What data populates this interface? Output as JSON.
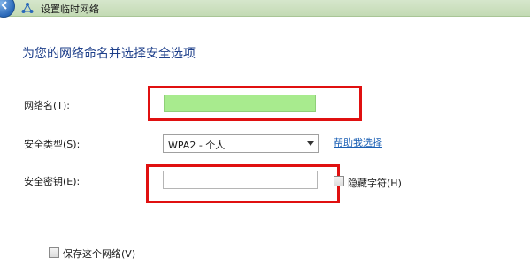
{
  "window": {
    "title": "设置临时网络",
    "back_icon": "back-arrow-icon",
    "title_icon": "network-icon"
  },
  "heading": "为您的网络命名并选择安全选项",
  "form": {
    "network_name_label": "网络名(T):",
    "network_name_value": "",
    "security_type_label": "安全类型(S):",
    "security_type_value": "WPA2 - 个人",
    "help_link": "帮助我选择",
    "security_key_label": "安全密钥(E):",
    "security_key_value": "",
    "hide_chars_label": "隐藏字符(H)",
    "hide_chars_checked": false,
    "save_network_label": "保存这个网络(V)",
    "save_network_checked": false
  },
  "colors": {
    "highlight_box": "#e01010",
    "name_field_fill": "#a8eb8e",
    "heading": "#1e3f8a"
  }
}
